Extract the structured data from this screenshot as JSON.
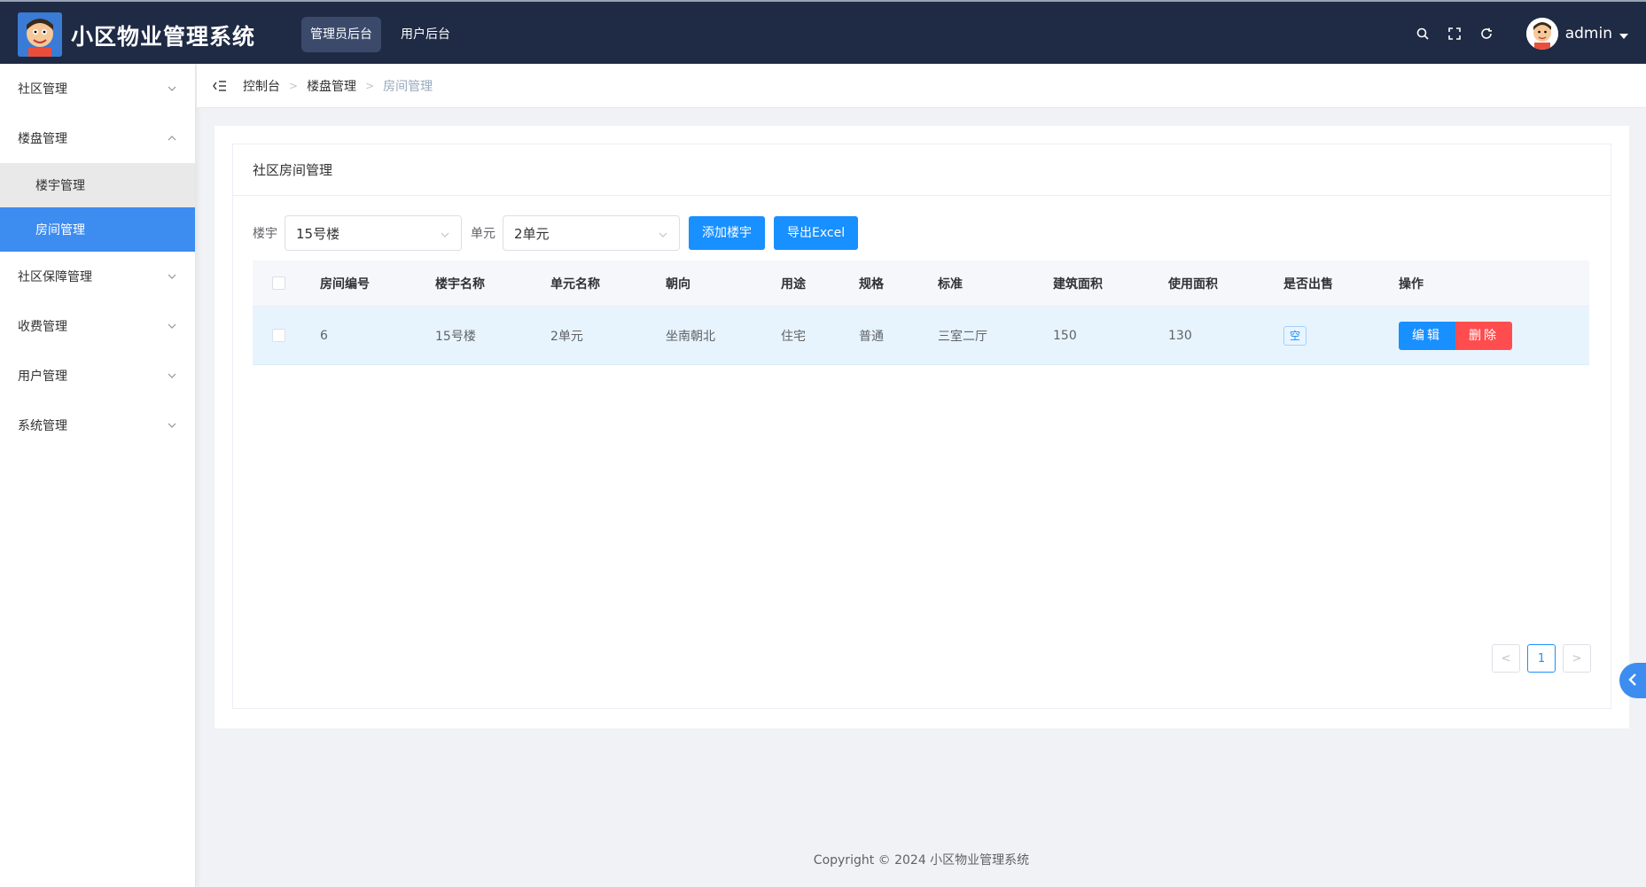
{
  "header": {
    "app_title": "小区物业管理系统",
    "nav": [
      {
        "label": "管理员后台",
        "active": true
      },
      {
        "label": "用户后台",
        "active": false
      }
    ],
    "tools": [
      "search-icon",
      "fullscreen-icon",
      "refresh-icon"
    ],
    "username": "admin"
  },
  "sidebar": {
    "items": [
      {
        "label": "社区管理",
        "expanded": false
      },
      {
        "label": "楼盘管理",
        "expanded": true,
        "children": [
          {
            "label": "楼宇管理",
            "state": "hover"
          },
          {
            "label": "房间管理",
            "state": "active"
          }
        ]
      },
      {
        "label": "社区保障管理",
        "expanded": false
      },
      {
        "label": "收费管理",
        "expanded": false
      },
      {
        "label": "用户管理",
        "expanded": false
      },
      {
        "label": "系统管理",
        "expanded": false
      }
    ]
  },
  "breadcrumb": [
    "控制台",
    "楼盘管理",
    "房间管理"
  ],
  "card": {
    "title": "社区房间管理"
  },
  "filters": {
    "building_label": "楼宇",
    "building_value": "15号楼",
    "unit_label": "单元",
    "unit_value": "2单元",
    "add_button": "添加楼宇",
    "export_button": "导出Excel"
  },
  "table": {
    "columns": [
      "房间编号",
      "楼宇名称",
      "单元名称",
      "朝向",
      "用途",
      "规格",
      "标准",
      "建筑面积",
      "使用面积",
      "是否出售",
      "操作"
    ],
    "rows": [
      {
        "room_no": "6",
        "building": "15号楼",
        "unit": "2单元",
        "orientation": "坐南朝北",
        "usage": "住宅",
        "spec": "普通",
        "standard": "三室二厅",
        "building_area": "150",
        "usable_area": "130",
        "sold": "空",
        "edit_label": "编辑",
        "delete_label": "删除"
      }
    ]
  },
  "pagination": {
    "prev": "<",
    "current": "1",
    "next": ">"
  },
  "footer": "Copyright © 2024 小区物业管理系统",
  "colors": {
    "header_bg": "#1f2a44",
    "primary": "#1890ff",
    "danger": "#ff4d4f",
    "sidebar_active": "#3d8cf0"
  }
}
